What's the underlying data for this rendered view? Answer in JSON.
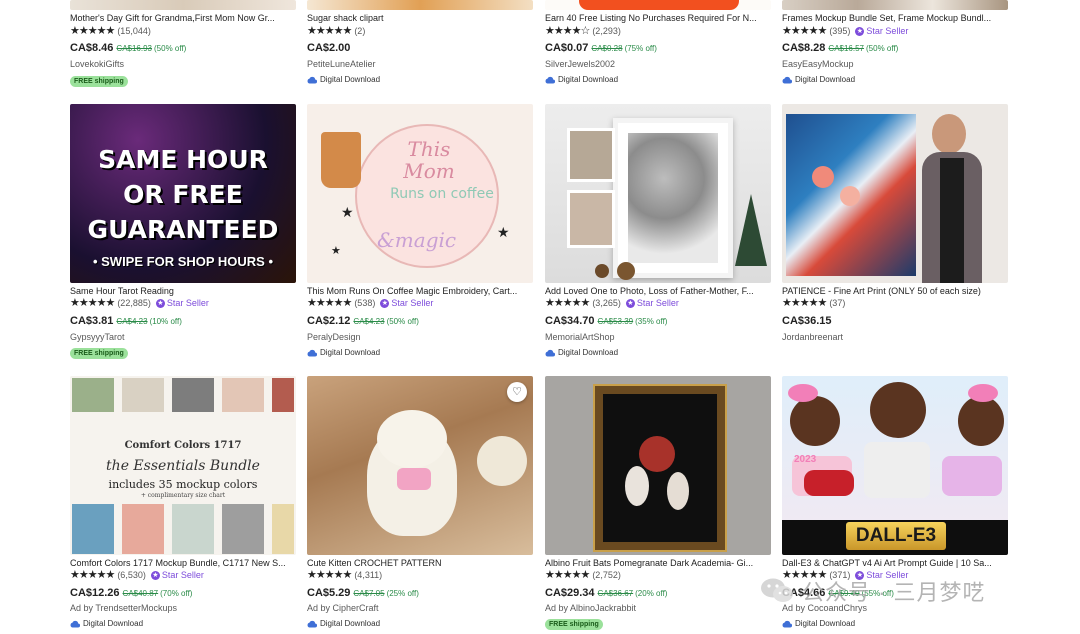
{
  "listings": [
    {
      "title": "Mother's Day Gift for Grandma,First Mom Now Gr...",
      "stars": "★★★★★",
      "reviews": "(15,044)",
      "star_seller": "",
      "price": "CA$8.46",
      "original": "CA$16.93",
      "discount": "(50% off)",
      "shop": "LovekokiGifts",
      "shipping": "FREE shipping",
      "download": ""
    },
    {
      "title": "Sugar shack clipart",
      "stars": "★★★★★",
      "reviews": "(2)",
      "star_seller": "",
      "price": "CA$2.00",
      "original": "",
      "discount": "",
      "shop": "PetiteLuneAtelier",
      "shipping": "",
      "download": "Digital Download"
    },
    {
      "title": "Earn 40 Free Listing No Purchases Required For N...",
      "stars": "★★★★☆",
      "reviews": "(2,293)",
      "star_seller": "",
      "price": "CA$0.07",
      "original": "CA$0.28",
      "discount": "(75% off)",
      "shop": "SilverJewels2002",
      "shipping": "",
      "download": "Digital Download"
    },
    {
      "title": "Frames Mockup Bundle Set, Frame Mockup Bundl...",
      "stars": "★★★★★",
      "reviews": "(395)",
      "star_seller": "Star Seller",
      "price": "CA$8.28",
      "original": "CA$16.57",
      "discount": "(50% off)",
      "shop": "EasyEasyMockup",
      "shipping": "",
      "download": "Digital Download"
    },
    {
      "title": "Same Hour Tarot Reading",
      "stars": "★★★★★",
      "reviews": "(22,885)",
      "star_seller": "Star Seller",
      "price": "CA$3.81",
      "original": "CA$4.23",
      "discount": "(10% off)",
      "shop": "GypsyyyTarot",
      "shipping": "FREE shipping",
      "download": "",
      "image_text": [
        "SAME HOUR",
        "OR FREE",
        "GUARANTEED",
        "• SWIPE FOR SHOP HOURS •"
      ]
    },
    {
      "title": "This Mom Runs On Coffee Magic Embroidery, Cart...",
      "stars": "★★★★★",
      "reviews": "(538)",
      "star_seller": "Star Seller",
      "price": "CA$2.12",
      "original": "CA$4.23",
      "discount": "(50% off)",
      "shop": "PeralyDesign",
      "shipping": "",
      "download": "Digital Download",
      "image_text": [
        "This",
        "Mom",
        "Runs",
        "on",
        "coffee",
        "&magic"
      ]
    },
    {
      "title": "Add Loved One to Photo, Loss of Father-Mother, F...",
      "stars": "★★★★★",
      "reviews": "(3,265)",
      "star_seller": "Star Seller",
      "price": "CA$34.70",
      "original": "CA$53.39",
      "discount": "(35% off)",
      "shop": "MemorialArtShop",
      "shipping": "",
      "download": "Digital Download"
    },
    {
      "title": "PATIENCE - Fine Art Print (ONLY 50 of each size)",
      "stars": "★★★★★",
      "reviews": "(37)",
      "star_seller": "",
      "price": "CA$36.15",
      "original": "",
      "discount": "",
      "shop": "Jordanbreenart",
      "shipping": "",
      "download": ""
    },
    {
      "title": "Comfort Colors 1717 Mockup Bundle, C1717 New S...",
      "stars": "★★★★★",
      "reviews": "(6,530)",
      "star_seller": "Star Seller",
      "price": "CA$12.26",
      "original": "CA$40.87",
      "discount": "(70% off)",
      "shop": "Ad by TrendsetterMockups",
      "shipping": "",
      "download": "Digital Download",
      "image_text": [
        "Comfort Colors 1717",
        "the Essentials Bundle",
        "includes 35 mockup colors",
        "+ complimentary size chart"
      ]
    },
    {
      "title": "Cute Kitten CROCHET PATTERN",
      "stars": "★★★★★",
      "reviews": "(4,311)",
      "star_seller": "",
      "price": "CA$5.29",
      "original": "CA$7.05",
      "discount": "(25% off)",
      "shop": "Ad by CipherCraft",
      "shipping": "",
      "download": "Digital Download"
    },
    {
      "title": "Albino Fruit Bats Pomegranate Dark Academia- Gi...",
      "stars": "★★★★★",
      "reviews": "(2,752)",
      "star_seller": "",
      "price": "CA$29.34",
      "original": "CA$36.67",
      "discount": "(20% off)",
      "shop": "Ad by AlbinoJackrabbit",
      "shipping": "FREE shipping",
      "download": ""
    },
    {
      "title": "Dall-E3 & ChatGPT v4 Ai Art Prompt Guide | 10 Sa...",
      "stars": "★★★★★",
      "reviews": "(371)",
      "star_seller": "Star Seller",
      "price": "CA$4.66",
      "original": "CA$9.40",
      "discount": "(55% off)",
      "shop": "Ad by CocoandChrys",
      "shipping": "",
      "download": "Digital Download",
      "image_text": [
        "DALL-E3",
        "2023"
      ]
    }
  ],
  "watermark": {
    "text": "公众号 · 三月梦呓"
  },
  "icons": {
    "favorite": "heart-icon",
    "download": "cloud-download-icon",
    "star_seller": "star-seller-badge-icon"
  },
  "colors": {
    "star_seller": "#7d4cdb",
    "discount": "#2a8b48",
    "free_shipping_bg": "#9be19b"
  }
}
